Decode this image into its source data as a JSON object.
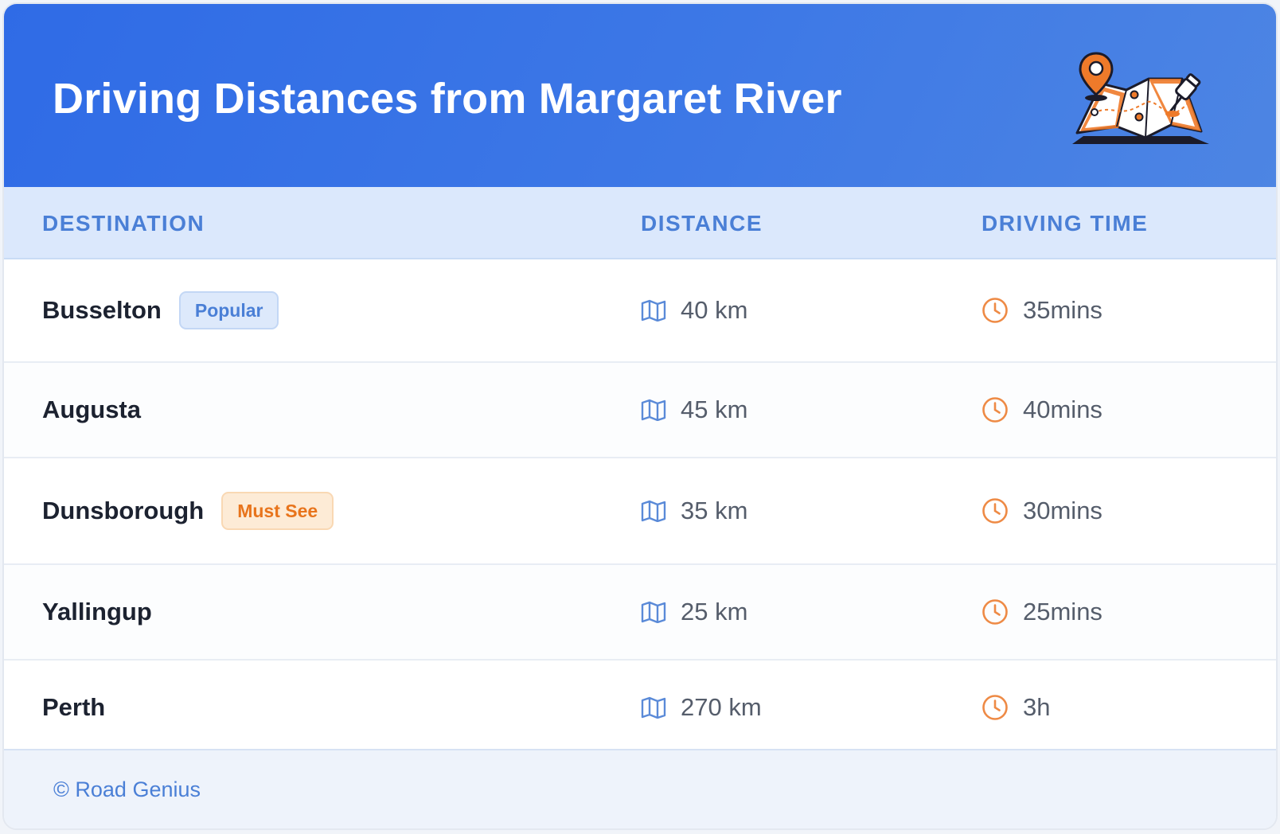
{
  "header": {
    "title": "Driving Distances from Margaret River",
    "illustration_icon": "map-with-pins-icon"
  },
  "columns": {
    "destination": "DESTINATION",
    "distance": "DISTANCE",
    "driving_time": "DRIVING TIME"
  },
  "rows": [
    {
      "destination": "Busselton",
      "badge": "Popular",
      "badge_style": "blue",
      "distance": "40 km",
      "time": "35mins"
    },
    {
      "destination": "Augusta",
      "badge": "",
      "badge_style": "",
      "distance": "45 km",
      "time": "40mins"
    },
    {
      "destination": "Dunsborough",
      "badge": "Must See",
      "badge_style": "orange",
      "distance": "35 km",
      "time": "30mins"
    },
    {
      "destination": "Yallingup",
      "badge": "",
      "badge_style": "",
      "distance": "25 km",
      "time": "25mins"
    },
    {
      "destination": "Perth",
      "badge": "",
      "badge_style": "",
      "distance": "270 km",
      "time": "3h"
    }
  ],
  "icons": {
    "distance": "map-icon",
    "time": "clock-icon"
  },
  "footer": {
    "copyright": "© Road Genius"
  },
  "colors": {
    "header_gradient_start": "#2f6be6",
    "header_gradient_end": "#4d85e3",
    "accent_blue": "#4a7fd6",
    "accent_orange": "#e8741c"
  }
}
